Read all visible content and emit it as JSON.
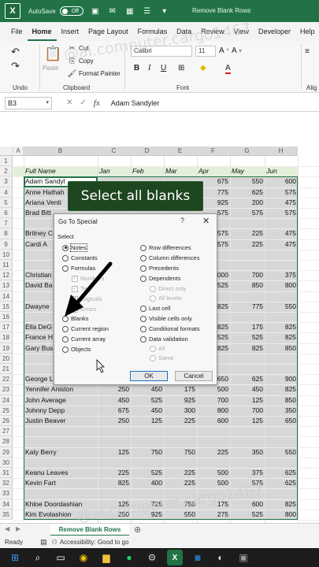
{
  "titlebar": {
    "autosave": "AutoSave",
    "autosave_state": "Off",
    "doc_title": "Remove Blank Rows"
  },
  "tabs": [
    "File",
    "Home",
    "Insert",
    "Page Layout",
    "Formulas",
    "Data",
    "Review",
    "View",
    "Developer",
    "Help"
  ],
  "ribbon": {
    "undo_label": "Undo",
    "paste_label": "Paste",
    "cut": "Cut",
    "copy": "Copy",
    "format_painter": "Format Painter",
    "clipboard_label": "Clipboard",
    "font_name": "Calibri",
    "font_size": "11",
    "bold": "B",
    "italic": "I",
    "underline": "U",
    "font_label": "Font",
    "align_label": "Alig"
  },
  "formula_bar": {
    "name_box": "B3",
    "value": "Adam Sandyler"
  },
  "grid": {
    "columns": [
      "A",
      "B",
      "C",
      "D",
      "E",
      "F",
      "G",
      "H"
    ],
    "header": {
      "name": "Full Name",
      "months": [
        "Jan",
        "Feb",
        "Mar",
        "Apr",
        "May",
        "Jun"
      ]
    },
    "rows": [
      {
        "n": "1",
        "name": "",
        "vals": [
          "",
          "",
          "",
          "",
          "",
          ""
        ]
      },
      {
        "n": "2",
        "name": "",
        "vals": [
          "",
          "",
          "",
          "",
          "",
          ""
        ]
      },
      {
        "n": "3",
        "name": "Adam Sandyl",
        "vals": [
          "",
          "",
          "",
          "675",
          "550",
          "600"
        ]
      },
      {
        "n": "4",
        "name": "Anne Hathah",
        "vals": [
          "",
          "",
          "",
          "775",
          "625",
          "575"
        ]
      },
      {
        "n": "5",
        "name": "Ariana Venti",
        "vals": [
          "",
          "",
          "",
          "925",
          "200",
          "475"
        ]
      },
      {
        "n": "6",
        "name": "Brad Bitt",
        "vals": [
          "",
          "",
          "",
          "575",
          "575",
          "575"
        ]
      },
      {
        "n": "7",
        "name": "",
        "vals": [
          "",
          "",
          "",
          "",
          "",
          ""
        ]
      },
      {
        "n": "8",
        "name": "Britney C",
        "vals": [
          "",
          "",
          "",
          "575",
          "225",
          "475"
        ]
      },
      {
        "n": "9",
        "name": "Cardi A",
        "vals": [
          "",
          "",
          "",
          "575",
          "225",
          "475"
        ]
      },
      {
        "n": "10",
        "name": "",
        "vals": [
          "",
          "",
          "",
          "",
          "",
          ""
        ]
      },
      {
        "n": "11",
        "name": "",
        "vals": [
          "",
          "",
          "",
          "",
          "",
          ""
        ]
      },
      {
        "n": "12",
        "name": "Christian",
        "vals": [
          "",
          "",
          "",
          "000",
          "700",
          "375"
        ]
      },
      {
        "n": "13",
        "name": "David Ba",
        "vals": [
          "",
          "",
          "",
          "525",
          "850",
          "800"
        ]
      },
      {
        "n": "14",
        "name": "",
        "vals": [
          "",
          "",
          "",
          "",
          "",
          ""
        ]
      },
      {
        "n": "15",
        "name": "Dwayne",
        "vals": [
          "",
          "",
          "",
          "825",
          "775",
          "550"
        ]
      },
      {
        "n": "16",
        "name": "",
        "vals": [
          "",
          "",
          "",
          "",
          "",
          ""
        ]
      },
      {
        "n": "17",
        "name": "Ella DeG",
        "vals": [
          "",
          "",
          "",
          "825",
          "175",
          "825"
        ]
      },
      {
        "n": "18",
        "name": "France H",
        "vals": [
          "",
          "",
          "",
          "525",
          "525",
          "825"
        ]
      },
      {
        "n": "19",
        "name": "Gary Bus",
        "vals": [
          "",
          "",
          "",
          "825",
          "825",
          "850"
        ]
      },
      {
        "n": "20",
        "name": "",
        "vals": [
          "",
          "",
          "",
          "",
          "",
          ""
        ]
      },
      {
        "n": "21",
        "name": "",
        "vals": [
          "",
          "",
          "",
          "",
          "",
          ""
        ]
      },
      {
        "n": "22",
        "name": "George L",
        "vals": [
          "",
          "",
          "",
          "650",
          "625",
          "900"
        ]
      },
      {
        "n": "23",
        "name": "Yennifer Aniston",
        "vals": [
          "250",
          "450",
          "175",
          "500",
          "450",
          "825"
        ]
      },
      {
        "n": "24",
        "name": "John Average",
        "vals": [
          "450",
          "525",
          "925",
          "700",
          "125",
          "850"
        ]
      },
      {
        "n": "25",
        "name": "Johnny Depp",
        "vals": [
          "675",
          "450",
          "300",
          "800",
          "700",
          "350"
        ]
      },
      {
        "n": "26",
        "name": "Justin Beaver",
        "vals": [
          "250",
          "125",
          "225",
          "600",
          "125",
          "650"
        ]
      },
      {
        "n": "27",
        "name": "",
        "vals": [
          "",
          "",
          "",
          "",
          "",
          ""
        ]
      },
      {
        "n": "28",
        "name": "",
        "vals": [
          "",
          "",
          "",
          "",
          "",
          ""
        ]
      },
      {
        "n": "29",
        "name": "Katy Berry",
        "vals": [
          "125",
          "750",
          "750",
          "225",
          "350",
          "550"
        ]
      },
      {
        "n": "30",
        "name": "",
        "vals": [
          "",
          "",
          "",
          "",
          "",
          ""
        ]
      },
      {
        "n": "31",
        "name": "Keanu Leaves",
        "vals": [
          "225",
          "525",
          "225",
          "500",
          "375",
          "625"
        ]
      },
      {
        "n": "32",
        "name": "Kevin Fart",
        "vals": [
          "825",
          "400",
          "225",
          "500",
          "575",
          "625"
        ]
      },
      {
        "n": "33",
        "name": "",
        "vals": [
          "",
          "",
          "",
          "",
          "",
          ""
        ]
      },
      {
        "n": "34",
        "name": "Khloe Doordashian",
        "vals": [
          "125",
          "725",
          "750",
          "175",
          "600",
          "825"
        ]
      },
      {
        "n": "35",
        "name": "Kim Evolashion",
        "vals": [
          "250",
          "925",
          "550",
          "275",
          "525",
          "800"
        ]
      }
    ]
  },
  "banner": {
    "text": "Select all blanks"
  },
  "dialog": {
    "title": "Go To Special",
    "help": "?",
    "close": "✕",
    "select_label": "Select",
    "left_options": [
      "Notes",
      "Constants",
      "Formulas",
      "Blanks",
      "Current region",
      "Current array",
      "Objects"
    ],
    "formula_subs": [
      "Numbers",
      "Text",
      "Logicals",
      "Errors"
    ],
    "right_options": [
      "Row differences",
      "Column differences",
      "Precedents",
      "Dependents",
      "Last cell",
      "Visible cells only",
      "Conditional formats",
      "Data validation"
    ],
    "dep_subs": [
      "Direct only",
      "All levels"
    ],
    "dv_subs": [
      "All",
      "Same"
    ],
    "ok": "OK",
    "cancel": "Cancel"
  },
  "sheet_tab": "Remove Blank Rows",
  "status": {
    "ready": "Ready",
    "accessibility": "Accessibility: Good to go"
  },
  "watermark": "@ai.computer.cargo1467",
  "colors": {
    "excel_green": "#217346",
    "banner_bg": "#1e4620",
    "header_row": "#e2efd9",
    "selection": "#d7d7d7"
  }
}
